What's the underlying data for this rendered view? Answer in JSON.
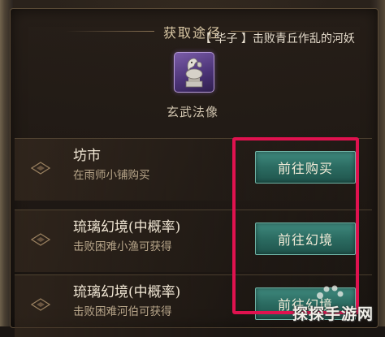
{
  "panel": {
    "title": "获取途径",
    "quest_text": "【 华子 】击败青丘作乱的河妖",
    "item": {
      "name": "玄武法像",
      "icon": "xuanwu-statue-icon"
    }
  },
  "sources": [
    {
      "title": "坊市",
      "subtitle": "在雨师小铺购买",
      "button": "前往购买"
    },
    {
      "title": "琉璃幻境(中概率)",
      "subtitle": "击败困难小渔可获得",
      "button": "前往幻境"
    },
    {
      "title": "琉璃幻境(中概率)",
      "subtitle": "击败困难河伯可获得",
      "button": "前往幻境"
    }
  ],
  "watermark": "探探手游网",
  "colors": {
    "button": "#2b6b61",
    "highlight": "#e0124f",
    "icon_bg": "#4a3275"
  }
}
